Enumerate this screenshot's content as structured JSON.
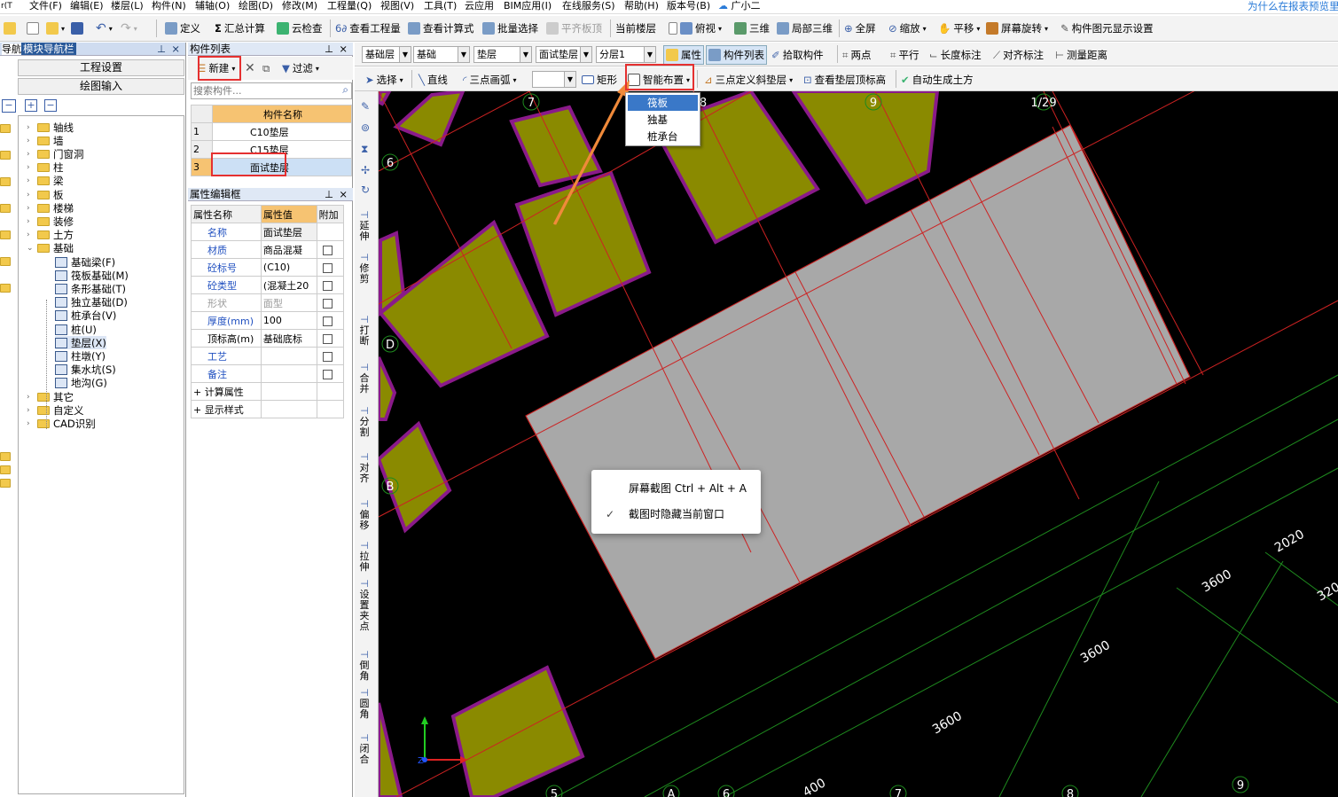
{
  "menu": [
    "文件(F)",
    "编辑(E)",
    "楼层(L)",
    "构件(N)",
    "辅轴(O)",
    "绘图(D)",
    "修改(M)",
    "工程量(Q)",
    "视图(V)",
    "工具(T)",
    "云应用",
    "BIM应用(I)",
    "在线服务(S)",
    "帮助(H)",
    "版本号(B)",
    "广小二"
  ],
  "top_right_link": "为什么在报表预览里",
  "toolbar1": {
    "define": "定义",
    "sum": "汇总计算",
    "cloud_check": "云检查",
    "view_qty": "查看工程量",
    "view_formula": "查看计算式",
    "batch_select": "批量选择",
    "flatten": "平齐板顶",
    "current_floor": "当前楼层",
    "top_view": "俯视",
    "three_d": "三维",
    "partial_3d": "局部三维",
    "fullscreen": "全屏",
    "zoom": "缩放",
    "pan": "平移",
    "rotate": "屏幕旋转",
    "display_settings": "构件图元显示设置"
  },
  "nav": {
    "title": "模块导航栏",
    "left_cut": "导航",
    "left_top": "r(T",
    "btn_project": "工程设置",
    "btn_draw": "绘图输入",
    "tree": [
      {
        "label": "轴线",
        "level": 0,
        "type": "folder",
        "open": false
      },
      {
        "label": "墙",
        "level": 0,
        "type": "folder",
        "open": false
      },
      {
        "label": "门窗洞",
        "level": 0,
        "type": "folder",
        "open": false
      },
      {
        "label": "柱",
        "level": 0,
        "type": "folder",
        "open": false
      },
      {
        "label": "梁",
        "level": 0,
        "type": "folder",
        "open": false
      },
      {
        "label": "板",
        "level": 0,
        "type": "folder",
        "open": false
      },
      {
        "label": "楼梯",
        "level": 0,
        "type": "folder",
        "open": false
      },
      {
        "label": "装修",
        "level": 0,
        "type": "folder",
        "open": false
      },
      {
        "label": "土方",
        "level": 0,
        "type": "folder",
        "open": false
      },
      {
        "label": "基础",
        "level": 0,
        "type": "folder",
        "open": true
      },
      {
        "label": "基础梁(F)",
        "level": 1,
        "type": "item"
      },
      {
        "label": "筏板基础(M)",
        "level": 1,
        "type": "item"
      },
      {
        "label": "条形基础(T)",
        "level": 1,
        "type": "item"
      },
      {
        "label": "独立基础(D)",
        "level": 1,
        "type": "item"
      },
      {
        "label": "桩承台(V)",
        "level": 1,
        "type": "item"
      },
      {
        "label": "桩(U)",
        "level": 1,
        "type": "item"
      },
      {
        "label": "垫层(X)",
        "level": 1,
        "type": "item",
        "selected": true
      },
      {
        "label": "柱墩(Y)",
        "level": 1,
        "type": "item"
      },
      {
        "label": "集水坑(S)",
        "level": 1,
        "type": "item"
      },
      {
        "label": "地沟(G)",
        "level": 1,
        "type": "item"
      },
      {
        "label": "其它",
        "level": 0,
        "type": "folder",
        "open": false
      },
      {
        "label": "自定义",
        "level": 0,
        "type": "folder",
        "open": false
      },
      {
        "label": "CAD识别",
        "level": 0,
        "type": "folder",
        "open": false
      }
    ]
  },
  "complist": {
    "title": "构件列表",
    "new": "新建",
    "filter": "过滤",
    "search_placeholder": "搜索构件...",
    "col_name": "构件名称",
    "rows": [
      {
        "no": "1",
        "name": "C10垫层"
      },
      {
        "no": "2",
        "name": "C15垫层"
      },
      {
        "no": "3",
        "name": "面试垫层"
      }
    ]
  },
  "props": {
    "title": "属性编辑框",
    "headers": [
      "属性名称",
      "属性值",
      "附加"
    ],
    "rows": [
      {
        "name": "名称",
        "value": "面试垫层",
        "blue": true,
        "check": false
      },
      {
        "name": "材质",
        "value": "商品混凝",
        "blue": true,
        "check": true
      },
      {
        "name": "砼标号",
        "value": "(C10)",
        "blue": true,
        "check": true
      },
      {
        "name": "砼类型",
        "value": "(混凝土20",
        "blue": true,
        "check": true
      },
      {
        "name": "形状",
        "value": "面型",
        "blue": false,
        "gray": true,
        "check": true
      },
      {
        "name": "厚度(mm)",
        "value": "100",
        "blue": true,
        "check": true
      },
      {
        "name": "顶标高(m)",
        "value": "基础底标",
        "blue": false,
        "check": true
      },
      {
        "name": "工艺",
        "value": "",
        "blue": true,
        "check": true
      },
      {
        "name": "备注",
        "value": "",
        "blue": true,
        "check": true
      },
      {
        "name": "计算属性",
        "value": "",
        "expand": true
      },
      {
        "name": "显示样式",
        "value": "",
        "expand": true
      }
    ]
  },
  "toolbar2": {
    "floor_type": "基础层",
    "category": "基础",
    "layer_type": "垫层",
    "component": "面试垫层",
    "sublayer": "分层1",
    "attr": "属性",
    "comp_list": "构件列表",
    "pick": "拾取构件",
    "two_points": "两点",
    "parallel": "平行",
    "length_mark": "长度标注",
    "align_mark": "对齐标注",
    "measure": "测量距离"
  },
  "toolbar3": {
    "select": "选择",
    "line": "直线",
    "arc": "三点画弧",
    "rect": "矩形",
    "smart": "智能布置",
    "slope": "三点定义斜垫层",
    "view_top": "查看垫层顶标高",
    "auto_gen": "自动生成土方"
  },
  "vtools": [
    "延伸",
    "修剪",
    "打断",
    "合并",
    "分割",
    "对齐",
    "偏移",
    "拉伸",
    "设置夹点",
    "倒角",
    "圆角",
    "闭合"
  ],
  "dropdown": [
    "筏板",
    "独基",
    "桩承台"
  ],
  "context_menu": {
    "capture": "屏幕截图 Ctrl + Alt + A",
    "hide": "截图时隐藏当前窗口"
  },
  "canvas_labels": {
    "axis": [
      "7",
      "8",
      "9",
      "1/29",
      "6",
      "D",
      "B",
      "5",
      "A",
      "6",
      "7",
      "8",
      "9"
    ],
    "dims": [
      "2020",
      "3600",
      "320",
      "3600",
      "3600",
      "400"
    ]
  }
}
